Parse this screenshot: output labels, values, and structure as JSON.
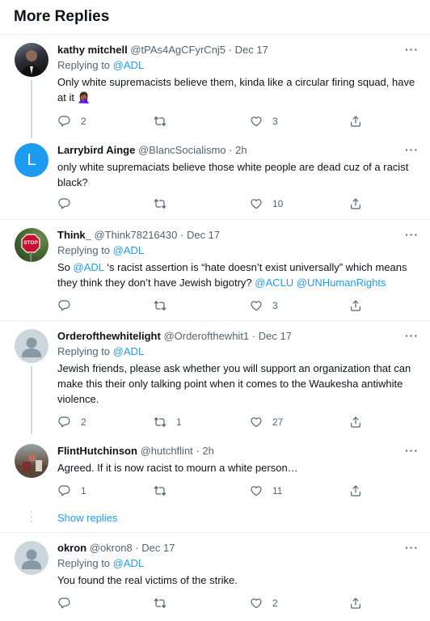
{
  "section_title": "More Replies",
  "icons": {
    "more": "more-horizontal-icon",
    "reply": "reply-icon",
    "retweet": "retweet-icon",
    "like": "heart-icon",
    "share": "share-icon"
  },
  "colors": {
    "link": "#1d9bf0",
    "secondary_text": "#536471",
    "avatar_default": "#1d9bf0"
  },
  "tweets": [
    {
      "name": "kathy mitchell",
      "handle": "@tPAs4AgCFyrCnj5",
      "sep": "·",
      "time": "Dec 17",
      "replying_prefix": "Replying to",
      "replying_to": "@ADL",
      "text": "Only white supremacists believe them, kinda like a circular firing squad, have at it 🤦🏾‍♀️",
      "reply_count": "2",
      "retweet_count": "",
      "like_count": "3"
    },
    {
      "name": "Larrybird Ainge",
      "handle": "@BlancSocialismo",
      "sep": "·",
      "time": "2h",
      "avatar_letter": "L",
      "text": "only white supremaciats believe those white people are dead cuz of a racist black?",
      "reply_count": "",
      "retweet_count": "",
      "like_count": "10"
    },
    {
      "name": "Think_",
      "handle": "@Think78216430",
      "sep": "·",
      "time": "Dec 17",
      "avatar_text": "STOP",
      "replying_prefix": "Replying to",
      "replying_to": "@ADL",
      "text_before": "So ",
      "mention1": "@ADL",
      "text_mid": " ‘s racist assertion is “hate doesn’t exist universally” which means they think they don’t have Jewish bigotry? ",
      "mention2": "@ACLU",
      "text_space": " ",
      "mention3": "@UNHumanRights",
      "reply_count": "",
      "retweet_count": "",
      "like_count": "3"
    },
    {
      "name": "Orderofthewhitelight",
      "handle": "@Orderofthewhit1",
      "sep": "·",
      "time": "Dec 17",
      "replying_prefix": "Replying to",
      "replying_to": "@ADL",
      "text": "Jewish friends, please ask whether you will support an organization that can make this their only talking point when it comes to the Waukesha antiwhite violence.",
      "reply_count": "2",
      "retweet_count": "1",
      "like_count": "27"
    },
    {
      "name": "FlintHutchinson",
      "handle": "@hutchflint",
      "sep": "·",
      "time": "2h",
      "text": "Agreed. If it is now racist to mourn a white person…",
      "reply_count": "1",
      "retweet_count": "",
      "like_count": "11"
    },
    {
      "name": "okron",
      "handle": "@okron8",
      "sep": "·",
      "time": "Dec 17",
      "replying_prefix": "Replying to",
      "replying_to": "@ADL",
      "text": "You found the real victims of the strike.",
      "reply_count": "",
      "retweet_count": "",
      "like_count": "2"
    }
  ],
  "show_replies": "Show replies"
}
